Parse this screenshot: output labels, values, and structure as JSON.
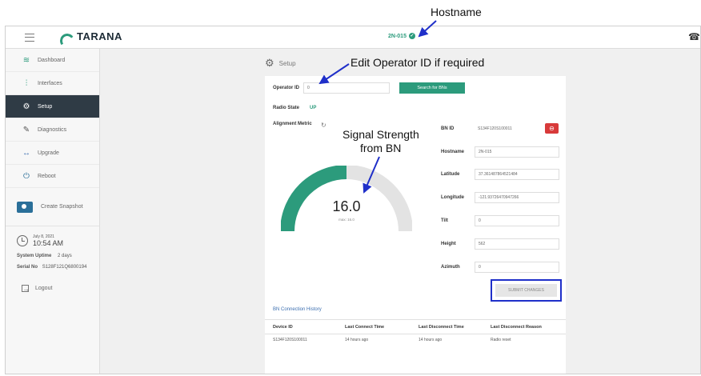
{
  "annotations": {
    "hostname": "Hostname",
    "operator": "Edit Operator ID if required",
    "signal_line1": "Signal Strength",
    "signal_line2": "from BN"
  },
  "topbar": {
    "brand": "TARANA",
    "hostname": "2N-015",
    "hostname_status_icon": "check-circle-icon",
    "bell_icon": "bell-icon"
  },
  "sidebar": {
    "items": [
      {
        "label": "Dashboard",
        "icon": "wifi-icon"
      },
      {
        "label": "Interfaces",
        "icon": "sliders-icon"
      },
      {
        "label": "Setup",
        "icon": "gears-icon",
        "active": true
      },
      {
        "label": "Diagnostics",
        "icon": "wrench-icon"
      },
      {
        "label": "Upgrade",
        "icon": "arrows-icon"
      },
      {
        "label": "Reboot",
        "icon": "power-icon"
      }
    ],
    "snapshot_label": "Create Snapshot",
    "date": "July 8, 2021",
    "time": "10:54 AM",
    "uptime_label": "System Uptime",
    "uptime_value": "2 days",
    "serial_label": "Serial No",
    "serial_value": "S128F121Q6800194",
    "logout_label": "Logout"
  },
  "setup": {
    "title": "Setup",
    "operator_id_label": "Operator ID",
    "operator_id_value": "0",
    "search_button": "Search for BNs",
    "radio_state_label": "Radio State",
    "radio_state_value": "UP",
    "alignment_metric_label": "Alignment Metric",
    "gauge_value": "16.0",
    "gauge_max": "max: 16.0",
    "gauge_fraction": 0.5,
    "colors": {
      "accent": "#2c9b7c",
      "danger": "#d83a3a",
      "highlight": "#1f2fc9"
    },
    "fields": [
      {
        "label": "BN ID",
        "value": "S134F120S100011"
      },
      {
        "label": "Hostname",
        "value": "2N-015"
      },
      {
        "label": "Latitude",
        "value": "37.361487864521484"
      },
      {
        "label": "Longitude",
        "value": "-121.93726470947266"
      },
      {
        "label": "Tilt",
        "value": "0"
      },
      {
        "label": "Height",
        "value": "562"
      },
      {
        "label": "Azimuth",
        "value": "0"
      }
    ],
    "submit_button": "SUBMIT CHANGES",
    "history_link": "BN Connection History",
    "history_headers": [
      "Device ID",
      "Last Connect Time",
      "Last Disconnect Time",
      "Last Disconnect Reason"
    ],
    "history_rows": [
      [
        "S134F120S100011",
        "14 hours ago",
        "14 hours ago",
        "Radio reset"
      ]
    ]
  }
}
